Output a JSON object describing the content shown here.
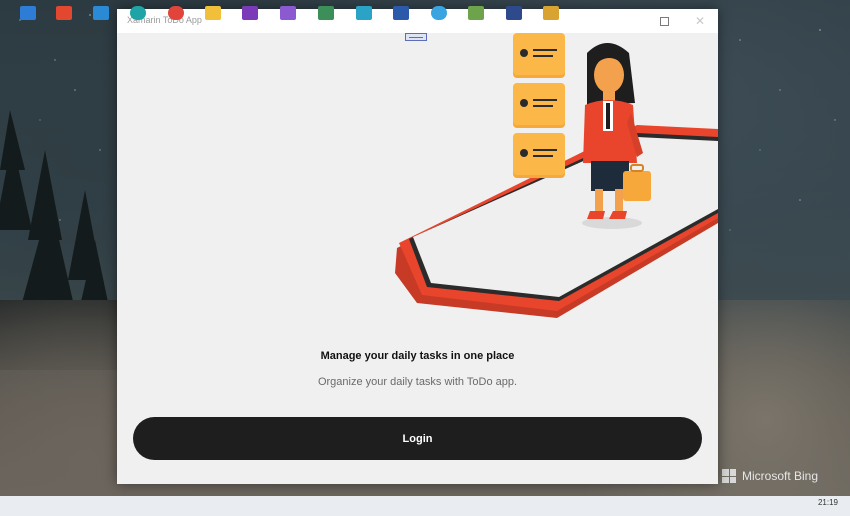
{
  "window": {
    "title": "Xamarin ToDo App"
  },
  "main": {
    "heading": "Manage your daily tasks in one place",
    "subheading": "Organize your daily tasks with ToDo app.",
    "login_label": "Login"
  },
  "desktop": {
    "watermark": "Microsoft Bing"
  },
  "taskbar": {
    "time": "21:19",
    "icons": [
      "start-icon",
      "office-icon",
      "mail-icon",
      "edge-icon",
      "chrome-icon",
      "file-explorer-icon",
      "onenote-icon",
      "visual-studio-icon",
      "app-icon",
      "app-icon-2",
      "word-icon",
      "telegram-icon",
      "notepad-icon",
      "save-icon",
      "pen-icon"
    ]
  },
  "colors": {
    "login_button": "#1e1e1e",
    "accent_orange": "#e8452c",
    "window_bg": "#f0f0f0"
  }
}
